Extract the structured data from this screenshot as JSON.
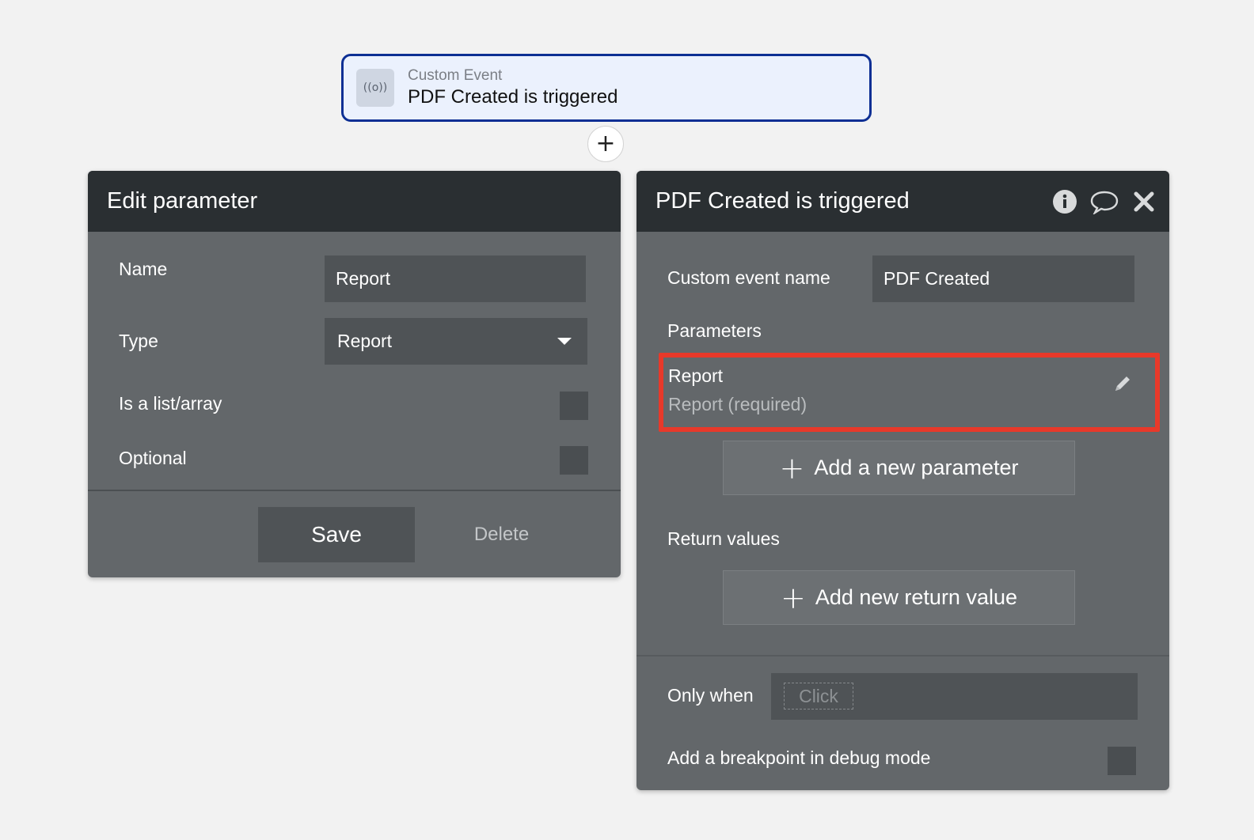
{
  "event_card": {
    "kind": "Custom Event",
    "title": "PDF Created is triggered",
    "icon": "broadcast-icon"
  },
  "add_step_symbol": "+",
  "edit_parameter": {
    "title": "Edit parameter",
    "name_label": "Name",
    "name_value": "Report",
    "type_label": "Type",
    "type_value": "Report",
    "list_label": "Is a list/array",
    "optional_label": "Optional",
    "save_label": "Save",
    "delete_label": "Delete"
  },
  "event_panel": {
    "title": "PDF Created is triggered",
    "custom_event_name_label": "Custom event name",
    "custom_event_name_value": "PDF Created",
    "parameters_label": "Parameters",
    "parameters": [
      {
        "name": "Report",
        "description": "Report (required)"
      }
    ],
    "add_parameter_label": "Add a new parameter",
    "return_values_label": "Return values",
    "add_return_label": "Add new return value",
    "only_when_label": "Only when",
    "only_when_placeholder": "Click",
    "breakpoint_label": "Add a breakpoint in debug mode"
  },
  "colors": {
    "highlight": "#e8392a",
    "event_border": "#0d2f94",
    "panel_header": "#2a2f32"
  }
}
